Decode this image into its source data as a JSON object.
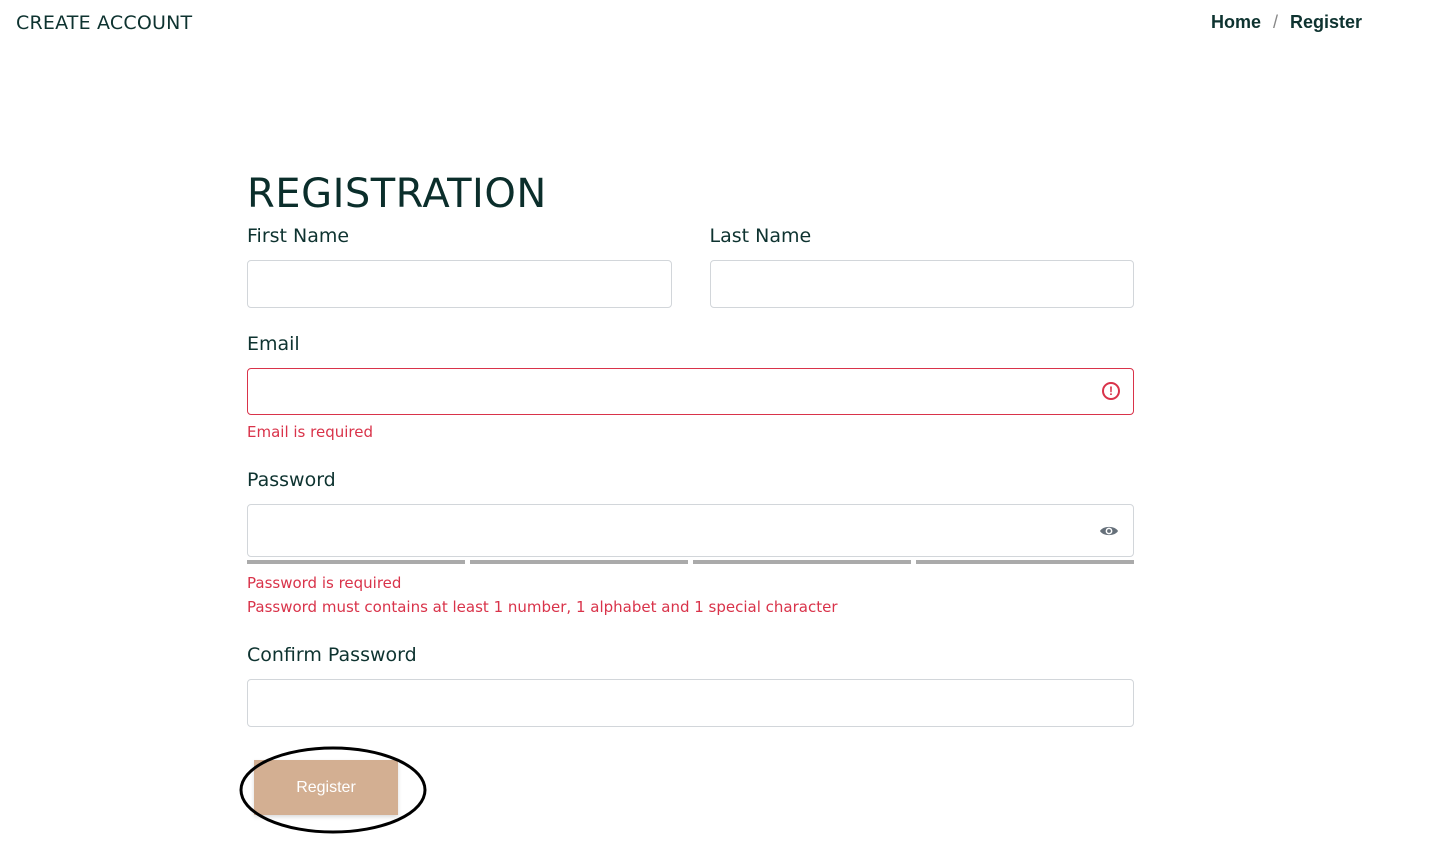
{
  "header": {
    "title": "CREATE ACCOUNT",
    "breadcrumb": {
      "home": "Home",
      "separator": "/",
      "current": "Register"
    }
  },
  "form": {
    "title": "REGISTRATION",
    "first_name": {
      "label": "First Name",
      "value": ""
    },
    "last_name": {
      "label": "Last Name",
      "value": ""
    },
    "email": {
      "label": "Email",
      "value": "",
      "error": "Email is required"
    },
    "password": {
      "label": "Password",
      "value": "",
      "errors": [
        "Password is required",
        "Password must contains at least 1 number, 1 alphabet and 1 special character"
      ],
      "strength_segments": 4,
      "strength_level": 0
    },
    "confirm_password": {
      "label": "Confirm Password",
      "value": ""
    },
    "submit_label": "Register"
  },
  "icons": {
    "email_status": "error-circle-icon",
    "password_toggle": "eye-icon"
  },
  "colors": {
    "error": "#d9334a",
    "button": "#d3af92",
    "heading": "#0b2e2b"
  }
}
